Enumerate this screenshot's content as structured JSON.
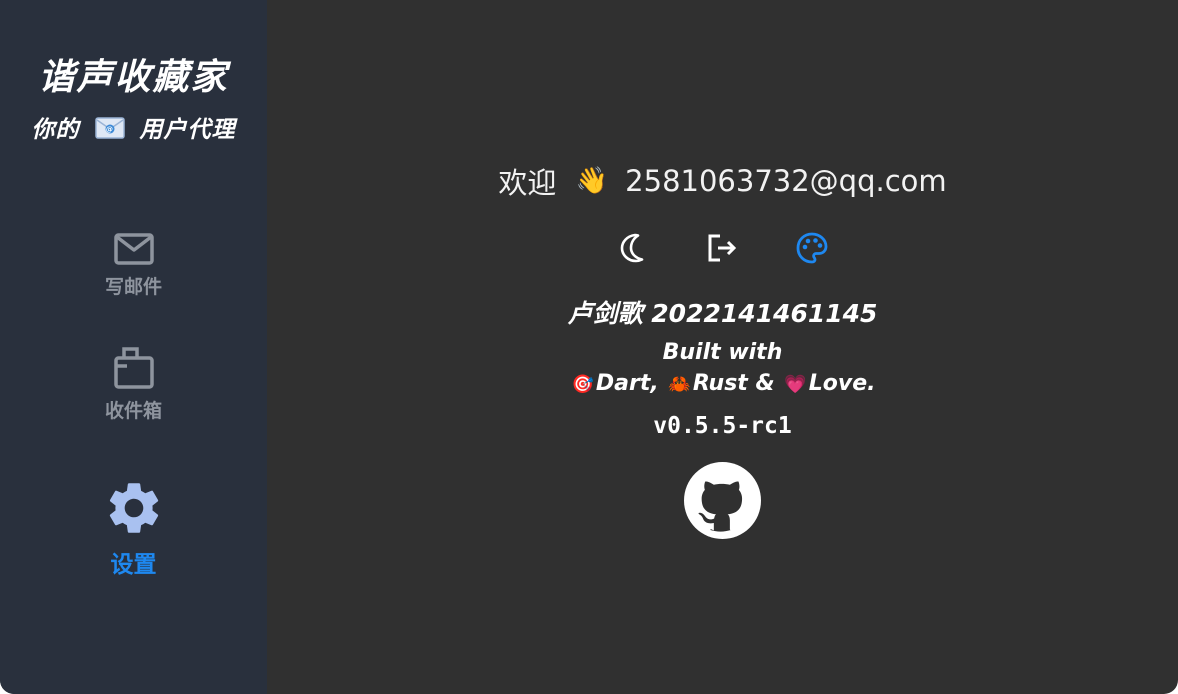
{
  "sidebar": {
    "title": "谐声收藏家",
    "subtitle_prefix": "你的",
    "subtitle_suffix": "用户代理",
    "subtitle_icon": "envelope-emoji",
    "items": [
      {
        "label": "写邮件",
        "icon": "mail-icon",
        "active": false
      },
      {
        "label": "收件箱",
        "icon": "inbox-icon",
        "active": false
      },
      {
        "label": "设置",
        "icon": "gear-icon",
        "active": true
      }
    ],
    "inactive_color": "#8e949e",
    "active_color": "#1e88f0",
    "background": "#29303d"
  },
  "main": {
    "welcome_label": "欢迎",
    "welcome_emoji": "👋",
    "email": "2581063732@qq.com",
    "actions": [
      {
        "name": "dark-mode",
        "icon": "moon-icon",
        "color": "#ffffff"
      },
      {
        "name": "logout",
        "icon": "logout-icon",
        "color": "#ffffff"
      },
      {
        "name": "theme",
        "icon": "palette-icon",
        "color": "#1e88f0"
      }
    ],
    "author": "卢剑歌 2022141461145",
    "built_with_line1": "Built with",
    "built_parts": [
      {
        "emoji": "🎯",
        "text": "Dart,"
      },
      {
        "emoji": "🦀",
        "text": "Rust &"
      },
      {
        "emoji": "💗",
        "text": "Love."
      }
    ],
    "version": "v0.5.5-rc1",
    "github_icon": "github-icon",
    "background": "#303030"
  }
}
